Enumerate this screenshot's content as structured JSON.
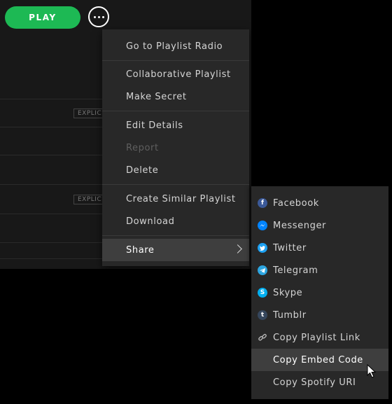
{
  "toolbar": {
    "play_label": "PLAY"
  },
  "tracks": {
    "explicit_label": "EXPLICIT"
  },
  "menu": {
    "items": [
      {
        "label": "Go to Playlist Radio"
      },
      {
        "label": "Collaborative Playlist"
      },
      {
        "label": "Make Secret"
      },
      {
        "label": "Edit Details"
      },
      {
        "label": "Report"
      },
      {
        "label": "Delete"
      },
      {
        "label": "Create Similar Playlist"
      },
      {
        "label": "Download"
      },
      {
        "label": "Share"
      }
    ]
  },
  "share_menu": {
    "items": [
      {
        "label": "Facebook",
        "icon": "facebook-icon"
      },
      {
        "label": "Messenger",
        "icon": "messenger-icon"
      },
      {
        "label": "Twitter",
        "icon": "twitter-icon"
      },
      {
        "label": "Telegram",
        "icon": "telegram-icon"
      },
      {
        "label": "Skype",
        "icon": "skype-icon"
      },
      {
        "label": "Tumblr",
        "icon": "tumblr-icon"
      },
      {
        "label": "Copy Playlist Link",
        "icon": "link-icon"
      },
      {
        "label": "Copy Embed Code"
      },
      {
        "label": "Copy Spotify URI"
      }
    ]
  },
  "colors": {
    "accent": "#1db954",
    "menu_bg": "#282828",
    "hover_bg": "#3e3e3e",
    "facebook": "#3b5998",
    "messenger": "#0084ff",
    "twitter": "#1da1f2",
    "telegram": "#2ca5e0",
    "skype": "#00aff0",
    "tumblr": "#35465c"
  }
}
